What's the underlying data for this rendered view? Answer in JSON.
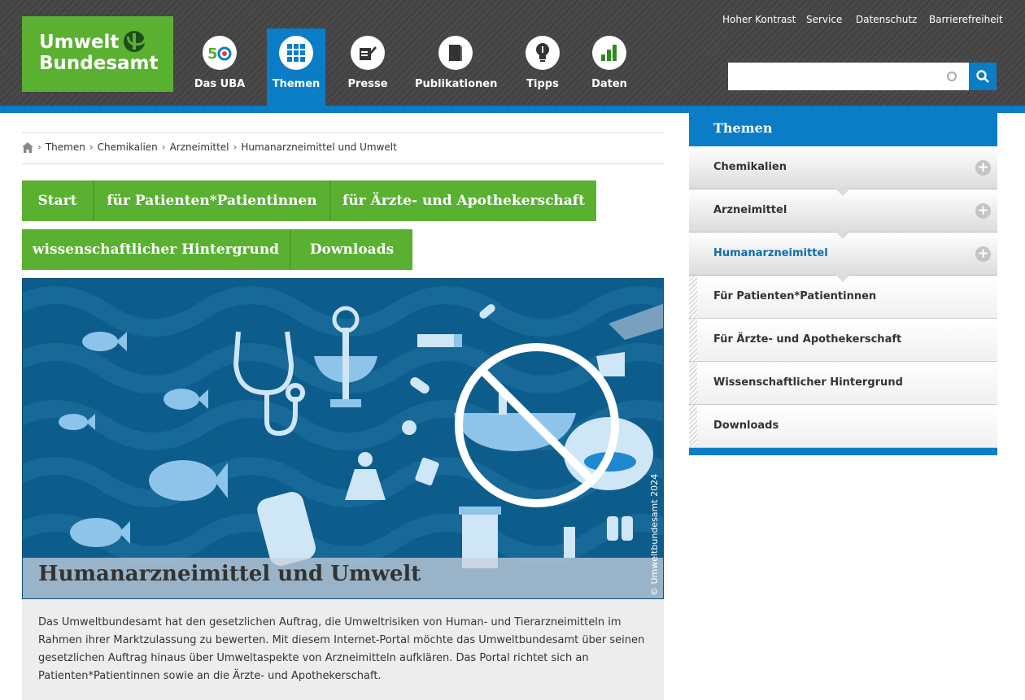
{
  "logo": {
    "line1": "Umwelt",
    "line2": "Bundesamt"
  },
  "nav": [
    {
      "label": "Das UBA",
      "icon": "anniversary-50-icon"
    },
    {
      "label": "Themen",
      "icon": "grid-icon"
    },
    {
      "label": "Presse",
      "icon": "pencil-paper-icon"
    },
    {
      "label": "Publikationen",
      "icon": "book-icon"
    },
    {
      "label": "Tipps",
      "icon": "lightbulb-icon"
    },
    {
      "label": "Daten",
      "icon": "bar-chart-icon"
    }
  ],
  "utility_links": [
    "Hoher Kontrast",
    "Service",
    "Datenschutz",
    "Barrierefreiheit"
  ],
  "search": {
    "placeholder": "",
    "value": ""
  },
  "breadcrumb": [
    "Themen",
    "Chemikalien",
    "Arzneimittel",
    "Humanarzneimittel und Umwelt"
  ],
  "tabs": [
    "Start",
    "für Patienten*Patientinnen",
    "für Ärzte- und Apothekerschaft",
    "wissenschaftlicher Hintergrund",
    "Downloads"
  ],
  "hero": {
    "title": "Humanarzneimittel und Umwelt",
    "copyright": "© Umweltbundesamt 2024"
  },
  "intro": "Das Umweltbundesamt hat den gesetzlichen Auftrag, die Umweltrisiken von Human- und Tierarzneimitteln im Rahmen ihrer Marktzulassung zu bewerten. Mit diesem Internet-Portal möchte das Umweltbundesamt über seinen gesetzlichen Auftrag hinaus über Umweltaspekte von Arzneimitteln aufklären. Das Portal richtet sich an Patienten*Patientinnen sowie an die Ärzte- und Apothekerschaft.",
  "sidebar": {
    "title": "Themen",
    "items": [
      {
        "label": "Chemikalien"
      },
      {
        "label": "Arzneimittel"
      },
      {
        "label": "Humanarzneimittel"
      }
    ],
    "subitems": [
      {
        "label": "Für Patienten*Patientinnen"
      },
      {
        "label": "Für Ärzte- und Apothekerschaft"
      },
      {
        "label": "Wissenschaftlicher Hintergrund"
      },
      {
        "label": "Downloads"
      }
    ]
  },
  "colors": {
    "brand_green": "#5ab031",
    "brand_blue": "#0b7dc6",
    "header_gray": "#4a4a4a"
  }
}
